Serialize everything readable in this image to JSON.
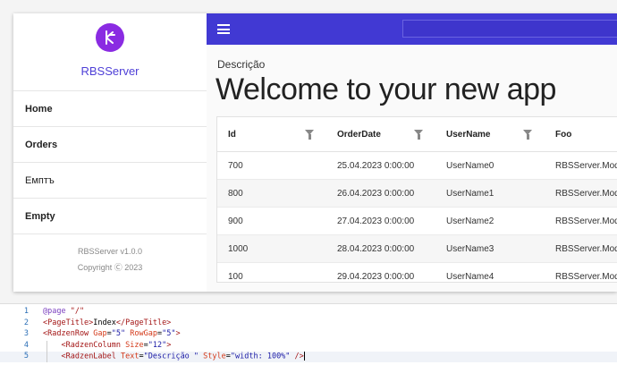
{
  "app": {
    "name": "RBSServer",
    "version_text": "RBSServer v1.0.0",
    "copyright_text": "Copyright Ⓒ 2023",
    "logo_icon": "brand-logo-icon",
    "colors": {
      "topbar": "#4139d3",
      "accent": "#4e3fd7",
      "logo": "#8a2be2"
    }
  },
  "nav": {
    "items": [
      {
        "label": "Home",
        "bold": true
      },
      {
        "label": "Orders",
        "bold": true
      },
      {
        "label": "Емптъ",
        "bold": false
      },
      {
        "label": "Empty",
        "bold": true
      }
    ]
  },
  "topbar": {
    "menu_icon": "hamburger-icon",
    "search_placeholder": ""
  },
  "page": {
    "label": "Descrição",
    "title": "Welcome to your new app"
  },
  "grid": {
    "columns": [
      "Id",
      "OrderDate",
      "UserName",
      "Foo"
    ],
    "rows": [
      [
        "700",
        "25.04.2023 0:00:00",
        "UserName0",
        "RBSServer.Mod"
      ],
      [
        "800",
        "26.04.2023 0:00:00",
        "UserName1",
        "RBSServer.Mod"
      ],
      [
        "900",
        "27.04.2023 0:00:00",
        "UserName2",
        "RBSServer.Mod"
      ],
      [
        "1000",
        "28.04.2023 0:00:00",
        "UserName3",
        "RBSServer.Mod"
      ],
      [
        "100",
        "29.04.2023 0:00:00",
        "UserName4",
        "RBSServer.Mod"
      ]
    ]
  },
  "editor": {
    "lines": [
      {
        "n": "1",
        "parts": [
          [
            "t-dir",
            "@page "
          ],
          [
            "t-str",
            "\"/\""
          ]
        ]
      },
      {
        "n": "2",
        "parts": [
          [
            "t-tag",
            "<PageTitle>"
          ],
          [
            "t-txt",
            "Index"
          ],
          [
            "t-tag",
            "</PageTitle>"
          ]
        ]
      },
      {
        "n": "3",
        "parts": [
          [
            "t-tag",
            "<RadzenRow "
          ],
          [
            "t-attr",
            "Gap"
          ],
          [
            "t-txt",
            "="
          ],
          [
            "t-val",
            "\"5\""
          ],
          [
            "t-attr",
            " RowGap"
          ],
          [
            "t-txt",
            "="
          ],
          [
            "t-val",
            "\"5\""
          ],
          [
            "t-tag",
            ">"
          ]
        ]
      },
      {
        "n": "4",
        "parts": [
          [
            "t-txt",
            "    "
          ],
          [
            "t-tag",
            "<RadzenColumn "
          ],
          [
            "t-attr",
            "Size"
          ],
          [
            "t-txt",
            "="
          ],
          [
            "t-val",
            "\"12\""
          ],
          [
            "t-tag",
            ">"
          ]
        ]
      },
      {
        "n": "5",
        "parts": [
          [
            "t-txt",
            "    "
          ],
          [
            "t-tag",
            "<RadzenLabel "
          ],
          [
            "t-attr",
            "Text"
          ],
          [
            "t-txt",
            "="
          ],
          [
            "t-val",
            "\"Descrição \""
          ],
          [
            "t-attr",
            " Style"
          ],
          [
            "t-txt",
            "="
          ],
          [
            "t-val",
            "\"width: 100%\""
          ],
          [
            "t-txt",
            " "
          ],
          [
            "t-tag",
            "/>"
          ]
        ]
      }
    ]
  }
}
